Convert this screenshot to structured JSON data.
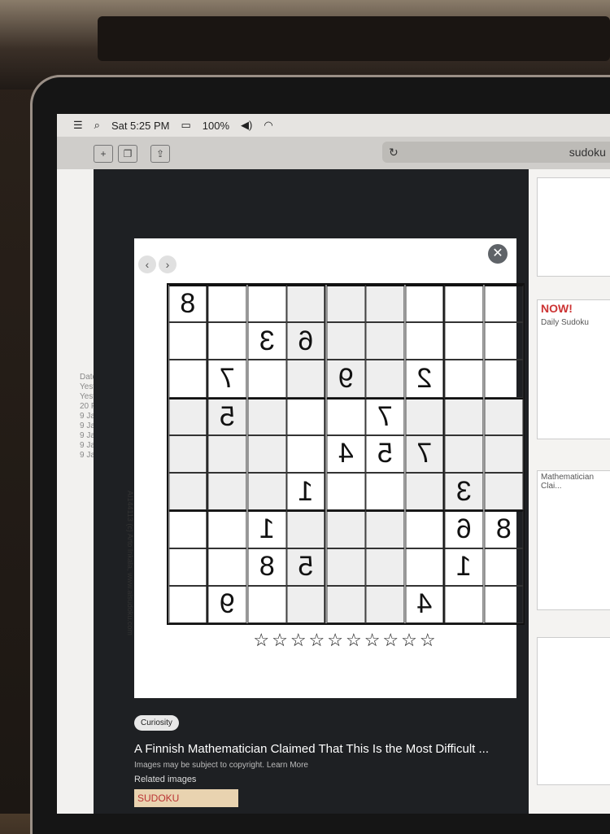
{
  "status_bar": {
    "time": "Sat 5:25 PM",
    "battery": "100%",
    "search_icon": "search-icon",
    "menu_icon": "menu-icon",
    "wifi_icon": "wifi-icon",
    "volume_icon": "volume-icon"
  },
  "browser": {
    "url_text": "sudoku",
    "tabs_icon": "tabs-icon",
    "share_icon": "share-icon",
    "reload_icon": "reload-icon",
    "new_tab_label": "+"
  },
  "sidebar": {
    "items": [
      "Date",
      "Yest",
      "Yest",
      "20 F",
      "9 Ja",
      "9 Ja",
      "9 Ja",
      "9 Ja",
      "9 Ja"
    ]
  },
  "viewer": {
    "close_label": "✕",
    "prev_label": "‹",
    "next_label": "›",
    "puzzle": {
      "rows": [
        [
          "8",
          "",
          "",
          "",
          "",
          "",
          "",
          "",
          ""
        ],
        [
          "",
          "",
          "3",
          "6",
          "",
          "",
          "",
          "",
          ""
        ],
        [
          "",
          "7",
          "",
          "",
          "9",
          "",
          "2",
          "",
          ""
        ],
        [
          "",
          "5",
          "",
          "",
          "",
          "7",
          "",
          "",
          ""
        ],
        [
          "",
          "",
          "",
          "",
          "4",
          "5",
          "7",
          "",
          ""
        ],
        [
          "",
          "",
          "",
          "1",
          "",
          "",
          "",
          "3",
          ""
        ],
        [
          "",
          "",
          "1",
          "",
          "",
          "",
          "",
          "6",
          "8"
        ],
        [
          "",
          "",
          "8",
          "5",
          "",
          "",
          "",
          "1",
          ""
        ],
        [
          "",
          "9",
          "",
          "",
          "",
          "",
          "4",
          "",
          ""
        ]
      ]
    },
    "stars": "☆☆☆☆☆☆☆☆☆☆",
    "copyright": "AI144113 (c) Arto Inkala, www.aisudoku.com",
    "source_chip": "Curiosity",
    "result_title": "A Finnish Mathematician Claimed That This Is the Most Difficult ...",
    "copyright_note": "Images may be subject to copyright. Learn More",
    "related_label": "Related images",
    "related_sudoku": "SUDOKU"
  },
  "right_column": {
    "caption1": "Daily Sudoku",
    "banner": "NOW!",
    "caption2": "Mathematician Clai..."
  }
}
